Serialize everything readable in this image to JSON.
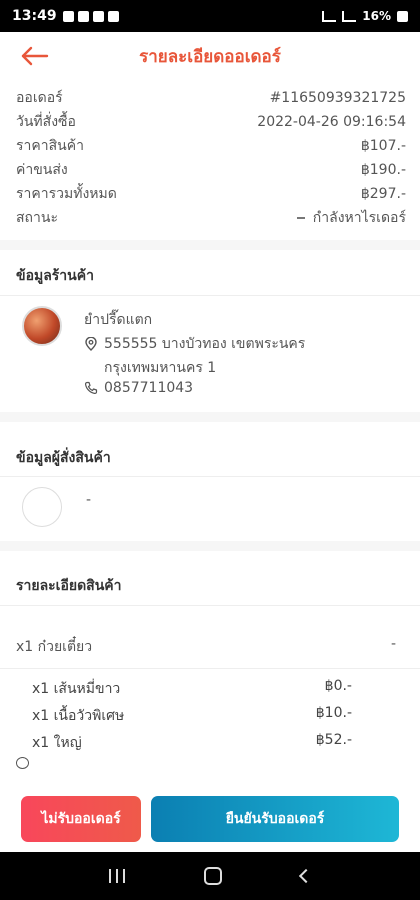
{
  "status_bar": {
    "time": "13:49",
    "battery": "16%"
  },
  "header": {
    "title": "รายละเอียดออเดอร์"
  },
  "summary": {
    "rows": [
      {
        "label": "ออเดอร์",
        "value": "#11650939321725"
      },
      {
        "label": "วันที่สั่งซื้อ",
        "value": "2022-04-26 09:16:54"
      },
      {
        "label": "ราคาสินค้า",
        "value": "฿107.-"
      },
      {
        "label": "ค่าขนส่ง",
        "value": "฿190.-"
      },
      {
        "label": "ราคารวมทั้งหมด",
        "value": "฿297.-"
      },
      {
        "label": "สถานะ",
        "value": "กำลังหาไรเดอร์"
      }
    ]
  },
  "shop": {
    "section_title": "ข้อมูลร้านค้า",
    "name": "ยำปรี๊ดแตก",
    "address_line1": "555555 บางบัวทอง เขตพระนคร",
    "address_line2": "กรุงเทพมหานคร 1",
    "phone": "0857711043"
  },
  "buyer": {
    "section_title": "ข้อมูลผู้สั่งสินค้า",
    "name": "-"
  },
  "items": {
    "section_title": "รายละเอียดสินค้า",
    "main_item": "x1 ก๋วยเตี๋ยว",
    "main_item_price": "-",
    "options": [
      {
        "name": "x1 เส้นหมี่ขาว",
        "price": "฿0.-"
      },
      {
        "name": "x1 เนื้อวัวพิเศษ",
        "price": "฿10.-"
      },
      {
        "name": "x1 ใหญ่",
        "price": "฿52.-"
      }
    ]
  },
  "actions": {
    "reject_label": "ไม่รับออเดอร์",
    "confirm_label": "ยืนยันรับออเดอร์"
  },
  "colors": {
    "accent": "#e8563a",
    "reject": "#f8475b",
    "confirm": "#0b7fb2"
  }
}
